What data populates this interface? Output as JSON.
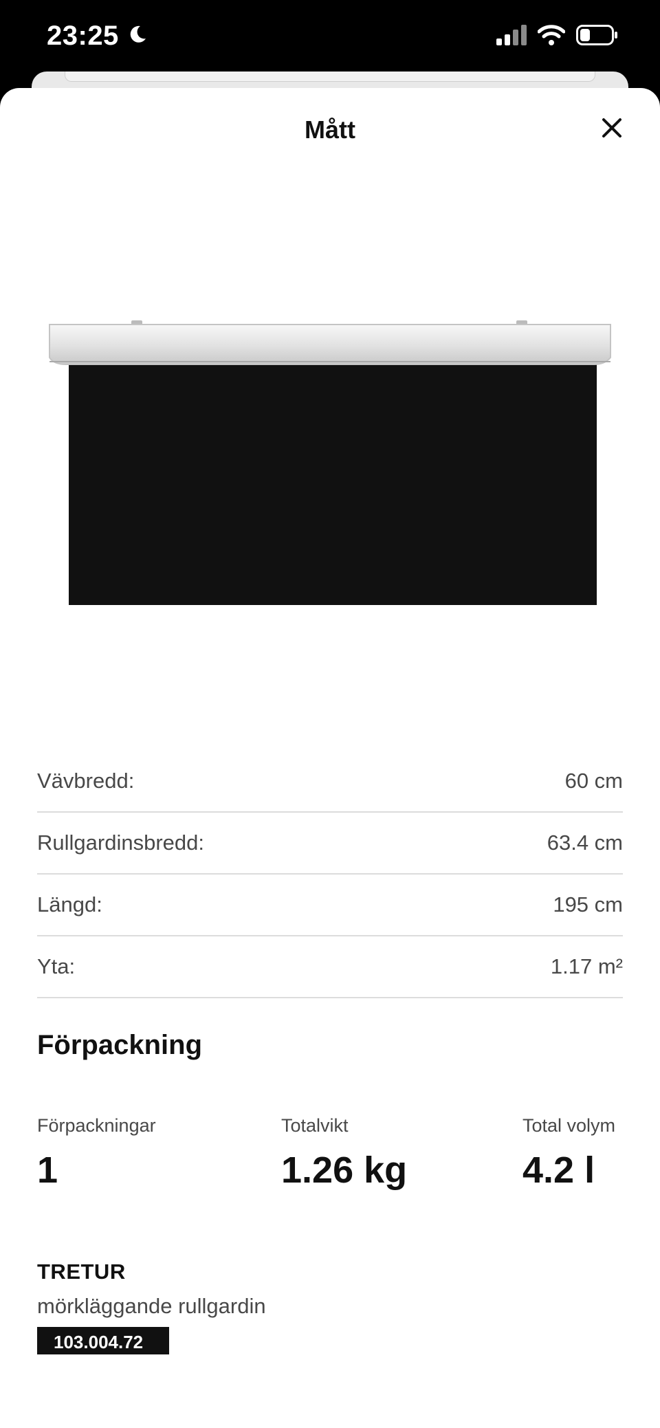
{
  "status_bar": {
    "time": "23:25",
    "icons": [
      "moon-icon",
      "cellular-signal-icon",
      "wifi-icon",
      "battery-icon"
    ]
  },
  "sheet": {
    "title": "Mått",
    "close_icon": "close-icon"
  },
  "product_image": {
    "description_icon": "roller-blind-image",
    "colors": {
      "blind": "#111111",
      "rail": "#e6e6e6"
    }
  },
  "dimensions": [
    {
      "label": "Vävbredd:",
      "value": "60 cm"
    },
    {
      "label": "Rullgardinsbredd:",
      "value": "63.4 cm"
    },
    {
      "label": "Längd:",
      "value": "195 cm"
    },
    {
      "label": "Yta:",
      "value": "1.17 m²"
    }
  ],
  "packaging": {
    "heading": "Förpackning",
    "items": [
      {
        "label": "Förpackningar",
        "value": "1"
      },
      {
        "label": "Totalvikt",
        "value": "1.26 kg"
      },
      {
        "label": "Total volym",
        "value": "4.2 l"
      }
    ]
  },
  "product": {
    "name": "TRETUR",
    "description": "mörkläggande rullgardin",
    "article_number": "103.004.72"
  }
}
